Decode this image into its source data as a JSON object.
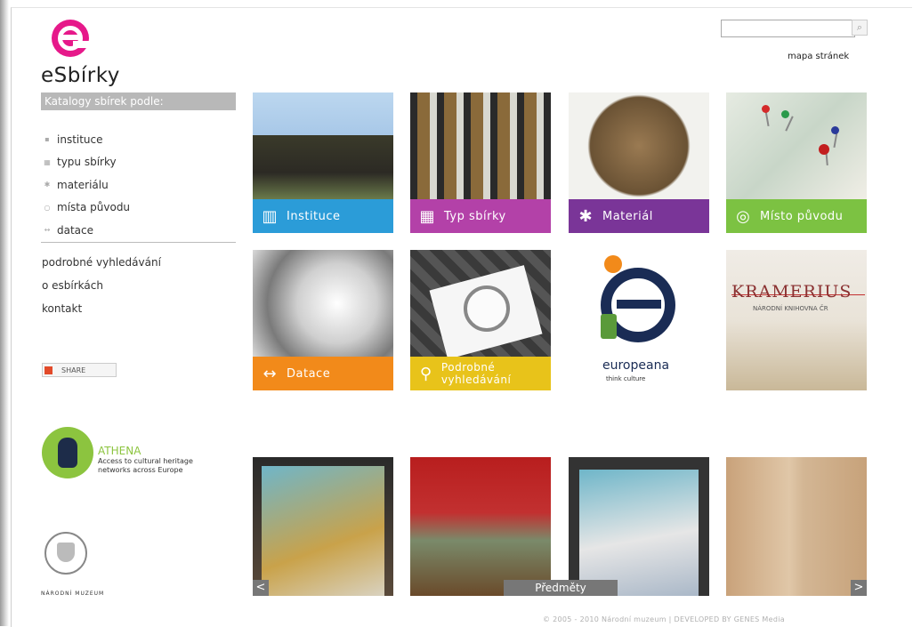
{
  "header": {
    "logo_text": "eSbírky",
    "search_placeholder": "",
    "sitemap_link": "mapa stránek"
  },
  "sidebar": {
    "catalog_heading": "Katalogy sbírek podle:",
    "catalog_items": [
      {
        "label": "instituce",
        "icon": "building-icon"
      },
      {
        "label": "typu sbírky",
        "icon": "grid-icon"
      },
      {
        "label": "materiálu",
        "icon": "star-icon"
      },
      {
        "label": "místa původu",
        "icon": "target-icon"
      },
      {
        "label": "datace",
        "icon": "arrows-icon"
      }
    ],
    "links": [
      "podrobné vyhledávání",
      "o esbírkách",
      "kontakt"
    ],
    "share_label": "SHARE",
    "athena_title": "ATHENA",
    "athena_subtitle": "Access to cultural heritage networks across Europe",
    "museum_label": "NÁRODNÍ MUZEUM"
  },
  "tiles": [
    {
      "label": "Instituce",
      "icon": "building-icon",
      "color": "#2b9cd8"
    },
    {
      "label": "Typ sbírky",
      "icon": "grid-icon",
      "color": "#b341a8"
    },
    {
      "label": "Materiál",
      "icon": "star-icon",
      "color": "#7a3598"
    },
    {
      "label": "Místo původu",
      "icon": "target-icon",
      "color": "#7cc242"
    },
    {
      "label": "Datace",
      "icon": "arrows-icon",
      "color": "#f28a1a"
    },
    {
      "label": "Podrobné vyhledávání",
      "icon": "magnifier-icon",
      "color": "#e8c31a"
    }
  ],
  "partners": {
    "europeana_word": "europeana",
    "europeana_tagline": "think culture",
    "kramerius_word": "KRAMERIUS",
    "kramerius_sub": "NÁRODNÍ KNIHOVNA ČR"
  },
  "gallery": {
    "label": "Předměty",
    "prev": "<",
    "next": ">"
  },
  "footer": "© 2005 - 2010 Národní muzeum | DEVELOPED BY GENES Media",
  "colors": {
    "brand_pink": "#e6198a",
    "athena_green": "#8cc43f"
  }
}
